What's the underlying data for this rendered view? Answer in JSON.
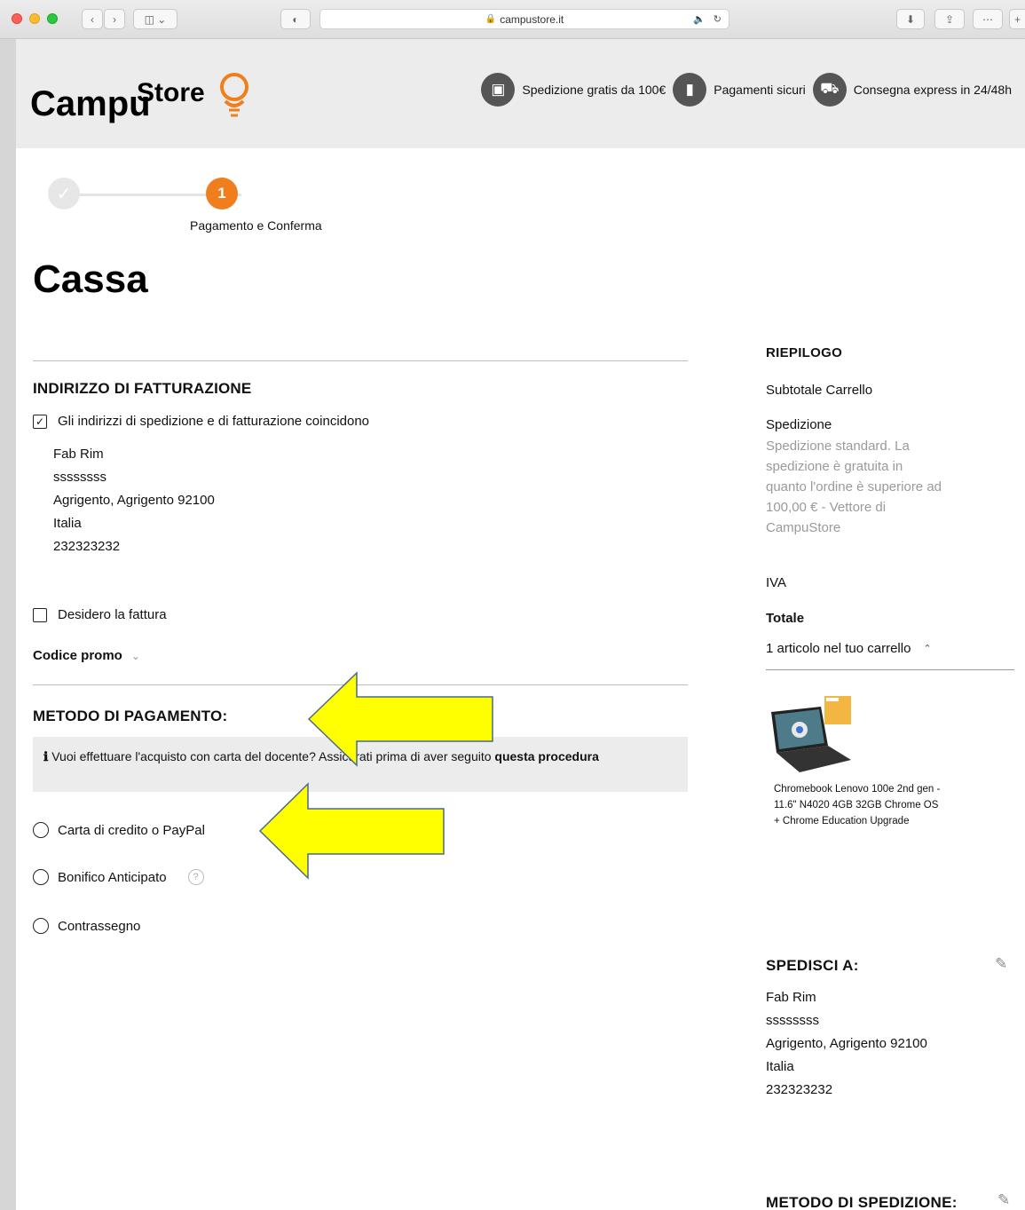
{
  "browser": {
    "url": "campustore.it"
  },
  "header": {
    "logo_text": "CampuStore",
    "usps": [
      {
        "icon": "box-icon",
        "label": "Spedizione gratis da 100€"
      },
      {
        "icon": "card-icon",
        "label": "Pagamenti sicuri"
      },
      {
        "icon": "truck-icon",
        "label": "Consegna express in 24/48h"
      }
    ]
  },
  "progress": {
    "current_step_number": "1",
    "current_step_label": "Pagamento e Conferma"
  },
  "page_title": "Cassa",
  "billing": {
    "title": "INDIRIZZO DI FATTURAZIONE",
    "same_address_label": "Gli indirizzi di spedizione e di fatturazione coincidono",
    "same_address_checked": true,
    "address_lines": [
      "Fab Rim",
      "ssssssss",
      "Agrigento, Agrigento 92100",
      "Italia",
      "232323232"
    ],
    "invoice_label": "Desidero la fattura",
    "invoice_checked": false,
    "promo_label": "Codice promo"
  },
  "payment": {
    "title": "METODO DI PAGAMENTO:",
    "notice_text": "Vuoi effettuare l'acquisto con carta del docente? Assicurati prima di aver seguito ",
    "notice_link": "questa procedura",
    "options": [
      "Carta di credito o PayPal",
      "Bonifico Anticipato",
      "Contrassegno"
    ]
  },
  "summary": {
    "title": "RIEPILOGO",
    "subtotal_label": "Subtotale Carrello",
    "shipping_label": "Spedizione",
    "shipping_note": "Spedizione standard. La spedizione è gratuita in quanto l'ordine è superiore ad 100,00 € - Vettore di CampuStore",
    "vat_label": "IVA",
    "total_label": "Totale",
    "cart_toggle": "1 articolo nel tuo carrello",
    "product_name": "Chromebook Lenovo 100e 2nd gen - 11.6\" N4020 4GB 32GB Chrome OS + Chrome Education Upgrade"
  },
  "ship_to": {
    "title": "SPEDISCI A:",
    "address_lines": [
      "Fab Rim",
      "ssssssss",
      "Agrigento, Agrigento 92100",
      "Italia",
      "232323232"
    ]
  },
  "shipping_method": {
    "title": "METODO DI SPEDIZIONE:"
  },
  "colors": {
    "accent": "#f07e1d",
    "annotation_arrow": "#ffff00"
  }
}
